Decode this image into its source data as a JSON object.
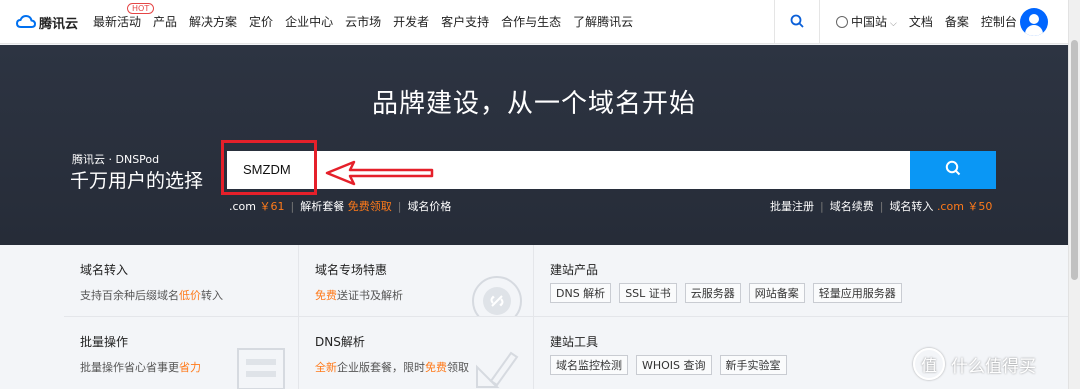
{
  "nav": {
    "logo": "腾讯云",
    "items": [
      "最新活动",
      "产品",
      "解决方案",
      "定价",
      "企业中心",
      "云市场",
      "开发者",
      "客户支持",
      "合作与生态",
      "了解腾讯云"
    ],
    "hot_badge": "HOT",
    "region": "中国站",
    "docs": "文档",
    "beian": "备案",
    "console": "控制台"
  },
  "hero": {
    "title": "品牌建设，从一个域名开始",
    "brand_small": "腾讯云 · DNSPod",
    "brand_big": "千万用户的选择",
    "search_value": "SMZDM",
    "sub_left": {
      "com_label": ".com",
      "com_price": "￥61",
      "dns_package": "解析套餐",
      "free_claim": "免费领取",
      "domain_price": "域名价格"
    },
    "sub_right": {
      "bulk_register": "批量注册",
      "renew": "域名续费",
      "transfer": "域名转入",
      "transfer_price": ".com ￥50"
    }
  },
  "cards": {
    "transfer": {
      "title": "域名转入",
      "desc_a": "支持百余种后缀域名",
      "desc_hl": "低价",
      "desc_b": "转入"
    },
    "special": {
      "title": "域名专场特惠",
      "desc_hl": "免费",
      "desc_b": "送证书及解析"
    },
    "build_products": {
      "title": "建站产品",
      "tags": [
        "DNS 解析",
        "SSL 证书",
        "云服务器",
        "网站备案",
        "轻量应用服务器"
      ]
    },
    "bulk": {
      "title": "批量操作",
      "desc_a": "批量操作省心省事更",
      "desc_hl": "省力"
    },
    "dns": {
      "title": "DNS解析",
      "desc_hl1": "全新",
      "desc_a": "企业版套餐，限时",
      "desc_hl2": "免费",
      "desc_b": "领取"
    },
    "build_tools": {
      "title": "建站工具",
      "tags": [
        "域名监控检测",
        "WHOIS 查询",
        "新手实验室"
      ]
    }
  },
  "watermark": {
    "glyph": "值",
    "text": "什么值得买"
  },
  "colors": {
    "accent_blue": "#0a97f5",
    "orange": "#ff7a1a",
    "annotation_red": "#e5202a",
    "hero_bg": "#2a303c"
  }
}
